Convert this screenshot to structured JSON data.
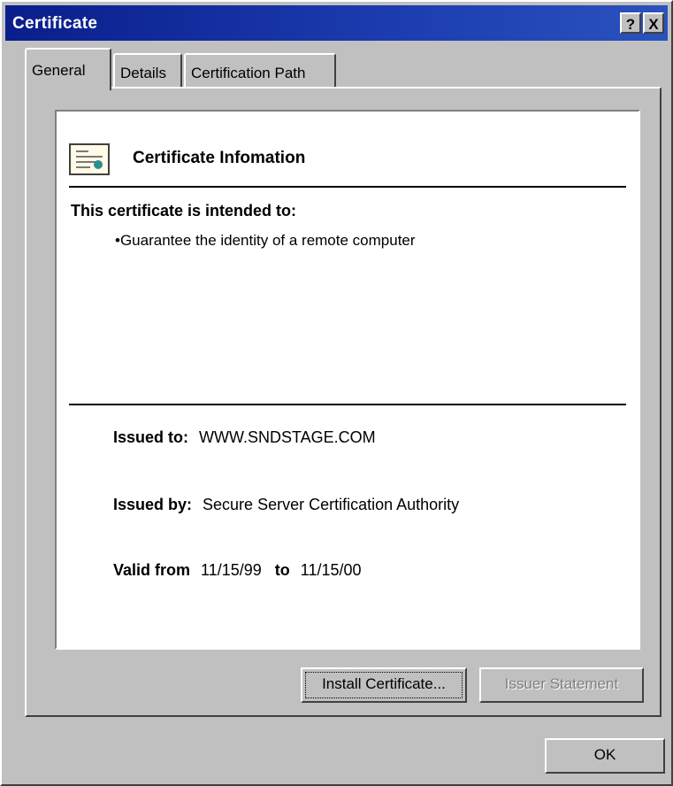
{
  "window": {
    "title": "Certificate",
    "help_button": "?",
    "close_button": "X"
  },
  "tabs": [
    {
      "label": "General",
      "active": true
    },
    {
      "label": "Details",
      "active": false
    },
    {
      "label": "Certification Path",
      "active": false
    }
  ],
  "info": {
    "heading": "Certificate Infomation",
    "intended_label": "This certificate is intended to:",
    "purposes": [
      "•Guarantee the identity of a remote computer"
    ],
    "issued_to_label": "Issued to:",
    "issued_to_value": "WWW.SNDSTAGE.COM",
    "issued_by_label": "Issued by:",
    "issued_by_value": "Secure Server Certification Authority",
    "valid_from_label": "Valid from",
    "valid_from_value": "11/15/99",
    "valid_to_label": "to",
    "valid_to_value": "11/15/00"
  },
  "buttons": {
    "install": "Install Certificate...",
    "issuer_statement": "Issuer Statement",
    "ok": "OK"
  },
  "icons": {
    "certificate": "certificate-icon",
    "help": "help-icon",
    "close": "close-icon"
  }
}
